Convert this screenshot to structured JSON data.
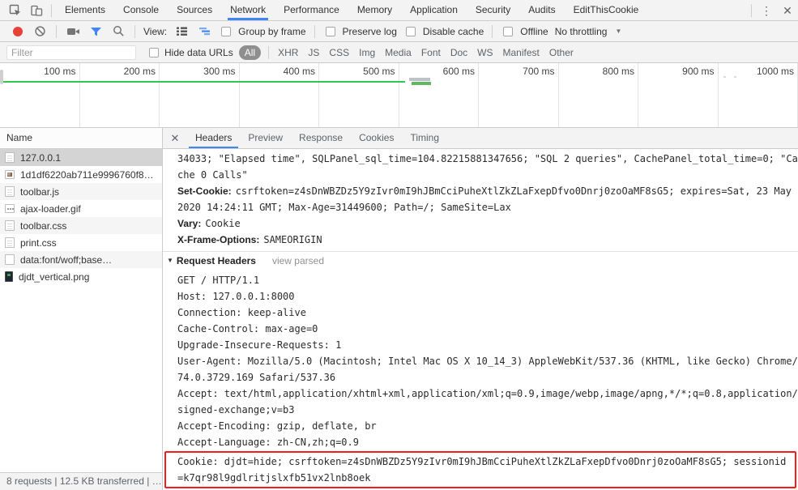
{
  "colors": {
    "accent_blue": "#4285f4",
    "timeline_green": "#31c553",
    "highlight_red": "#f71c1c",
    "record_red": "#e8413a"
  },
  "glyphs": {
    "more": "⋮",
    "close": "✕",
    "dropdown": "▼",
    "disclosure": "▼"
  },
  "main_tabs": [
    {
      "label": "Elements"
    },
    {
      "label": "Console"
    },
    {
      "label": "Sources"
    },
    {
      "label": "Network"
    },
    {
      "label": "Performance"
    },
    {
      "label": "Memory"
    },
    {
      "label": "Application"
    },
    {
      "label": "Security"
    },
    {
      "label": "Audits"
    },
    {
      "label": "EditThisCookie"
    }
  ],
  "toolbar": {
    "view_label": "View:",
    "group_by_frame": "Group by frame",
    "preserve_log": "Preserve log",
    "disable_cache": "Disable cache",
    "offline": "Offline",
    "throttling": "No throttling"
  },
  "filter": {
    "placeholder": "Filter",
    "hide_data_urls": "Hide data URLs",
    "types": [
      "All",
      "XHR",
      "JS",
      "CSS",
      "Img",
      "Media",
      "Font",
      "Doc",
      "WS",
      "Manifest",
      "Other"
    ]
  },
  "timeline": {
    "ticks": [
      "100 ms",
      "200 ms",
      "300 ms",
      "400 ms",
      "500 ms",
      "600 ms",
      "700 ms",
      "800 ms",
      "900 ms",
      "1000 ms"
    ]
  },
  "requests": {
    "header": "Name",
    "items": [
      {
        "name": "127.0.0.1"
      },
      {
        "name": "1d1df6220ab711e9996760f8…"
      },
      {
        "name": "toolbar.js"
      },
      {
        "name": "ajax-loader.gif"
      },
      {
        "name": "toolbar.css"
      },
      {
        "name": "print.css"
      },
      {
        "name": "data:font/woff;base…"
      },
      {
        "name": "djdt_vertical.png"
      }
    ]
  },
  "status_bar": "8 requests | 12.5 KB transferred | …",
  "detail": {
    "tabs": [
      {
        "label": "Headers"
      },
      {
        "label": "Preview"
      },
      {
        "label": "Response"
      },
      {
        "label": "Cookies"
      },
      {
        "label": "Timing"
      }
    ],
    "response_headers": [
      {
        "name": "",
        "value": "34033; \"Elapsed time\", SQLPanel_sql_time=104.82215881347656; \"SQL 2 queries\", CachePanel_total_time=0; \"Cache 0 Calls\""
      },
      {
        "name": "Set-Cookie:",
        "value": "csrftoken=z4sDnWBZDz5Y9zIvr0mI9hJBmCciPuheXtlZkZLaFxepDfvo0Dnrj0zoOaMF8sG5; expires=Sat, 23 May 2020 14:24:11 GMT; Max-Age=31449600; Path=/; SameSite=Lax"
      },
      {
        "name": "Vary:",
        "value": "Cookie"
      },
      {
        "name": "X-Frame-Options:",
        "value": "SAMEORIGIN"
      }
    ],
    "request_section": {
      "title": "Request Headers",
      "link": "view parsed"
    },
    "request_lines": [
      "GET / HTTP/1.1",
      "Host: 127.0.0.1:8000",
      "Connection: keep-alive",
      "Cache-Control: max-age=0",
      "Upgrade-Insecure-Requests: 1",
      "User-Agent: Mozilla/5.0 (Macintosh; Intel Mac OS X 10_14_3) AppleWebKit/537.36 (KHTML, like Gecko) Chrome/74.0.3729.169 Safari/537.36",
      "Accept: text/html,application/xhtml+xml,application/xml;q=0.9,image/webp,image/apng,*/*;q=0.8,application/signed-exchange;v=b3",
      "Accept-Encoding: gzip, deflate, br",
      "Accept-Language: zh-CN,zh;q=0.9"
    ],
    "cookie_line": "Cookie: djdt=hide; csrftoken=z4sDnWBZDz5Y9zIvr0mI9hJBmCciPuheXtlZkZLaFxepDfvo0Dnrj0zoOaMF8sG5; sessionid=k7qr98l9gdlritjslxfb51vx2lnb8oek"
  }
}
